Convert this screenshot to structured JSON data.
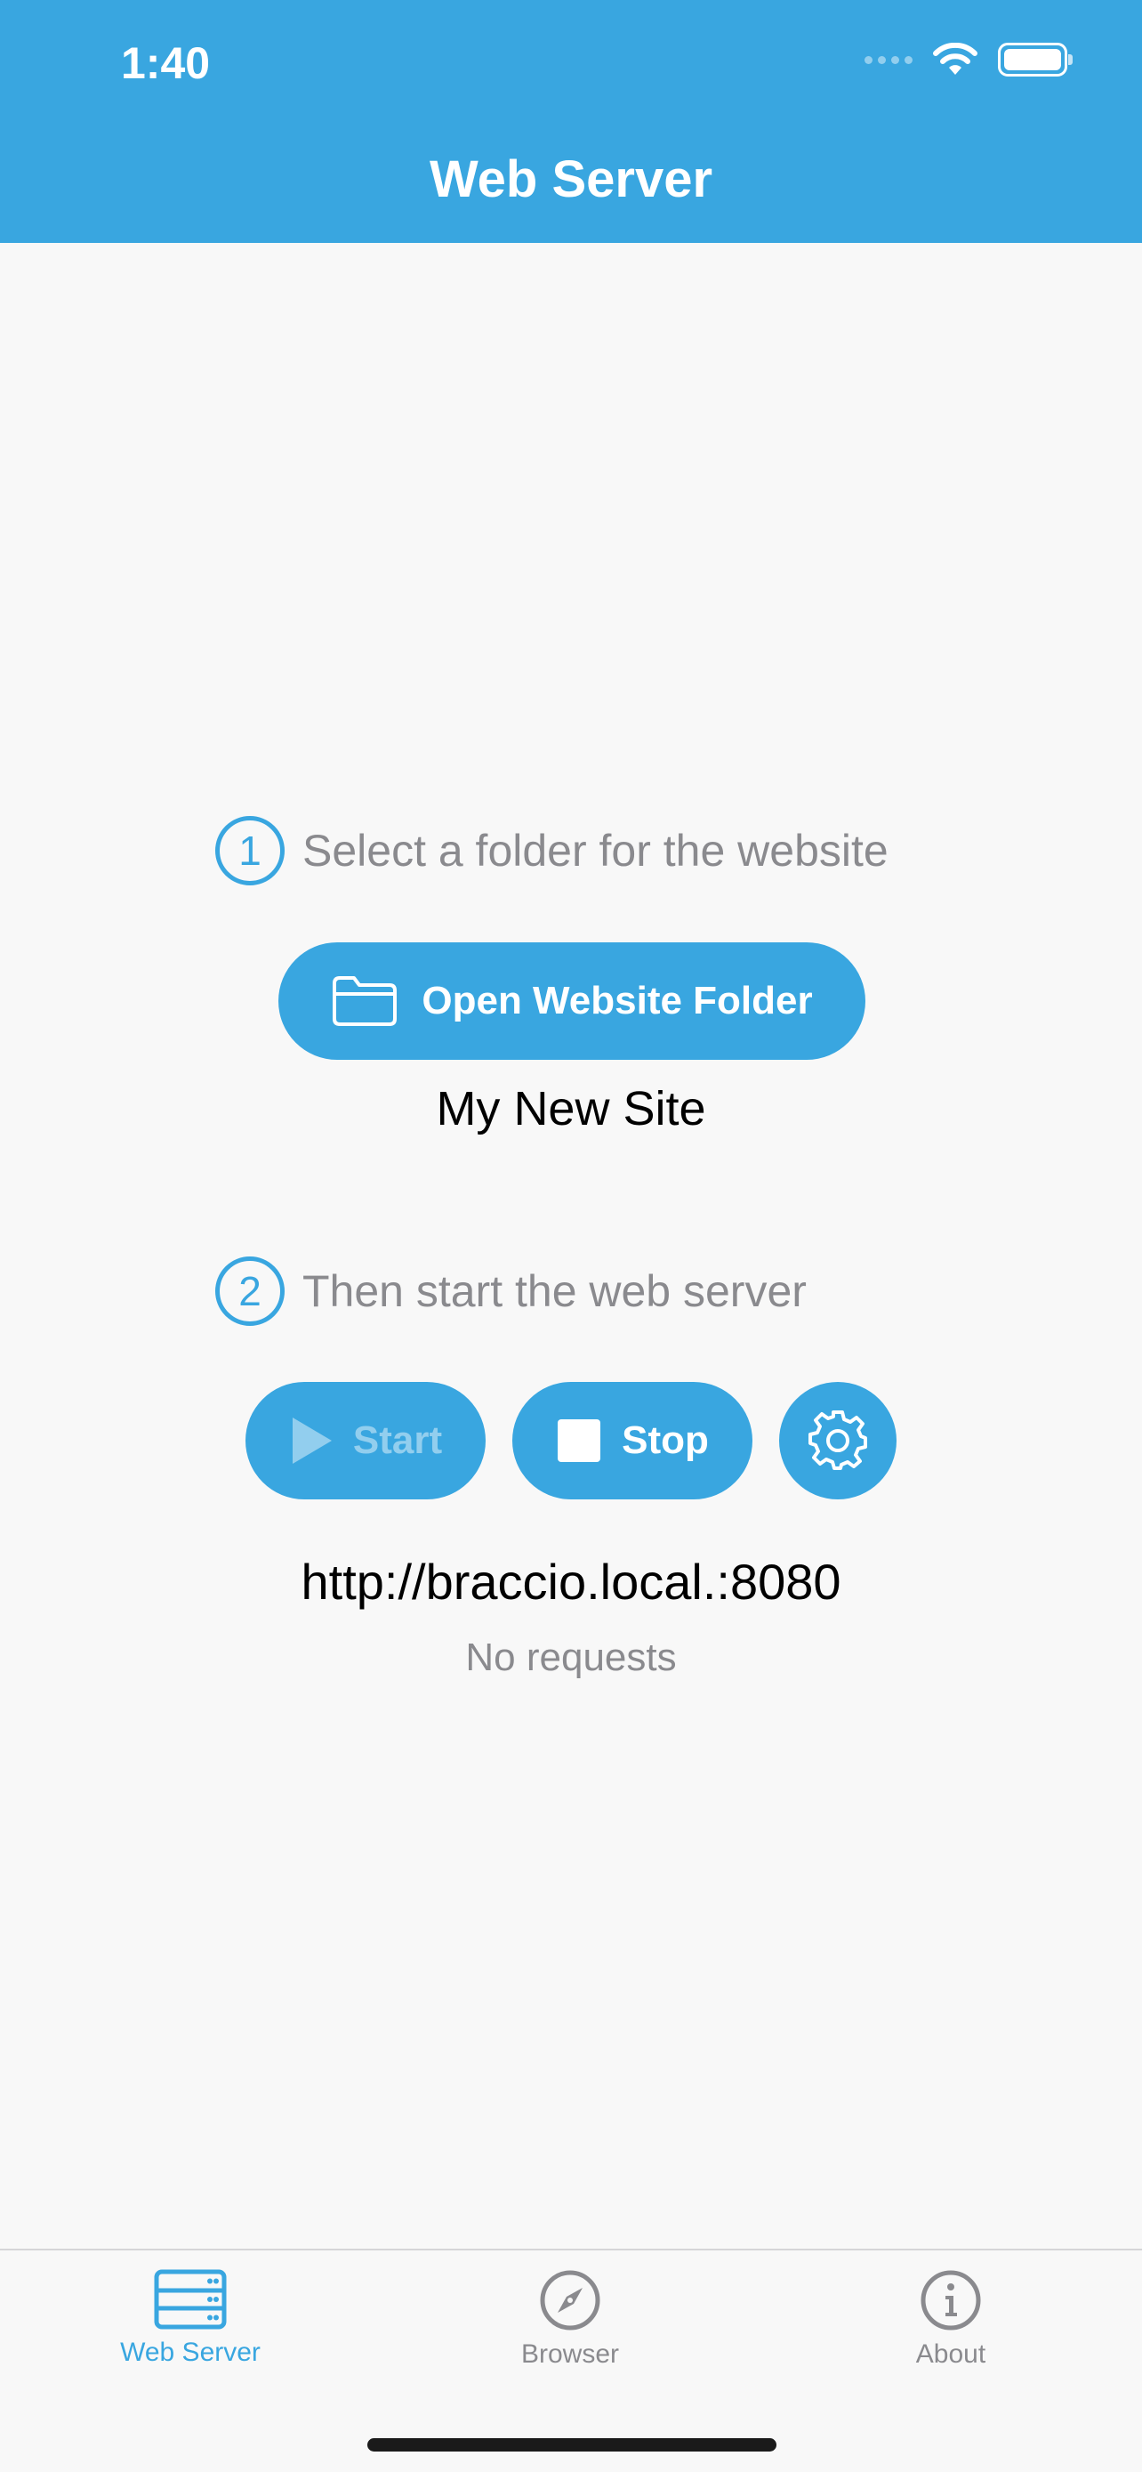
{
  "status_bar": {
    "time": "1:40"
  },
  "nav": {
    "title": "Web Server"
  },
  "step1": {
    "number": "1",
    "text": "Select a folder for the website"
  },
  "open_button": {
    "label": "Open Website Folder",
    "icon": "folder-icon"
  },
  "site": {
    "name": "My New Site"
  },
  "step2": {
    "number": "2",
    "text": "Then start the web server"
  },
  "controls": {
    "start_label": "Start",
    "start_enabled": false,
    "stop_label": "Stop",
    "settings_icon": "gear-icon"
  },
  "server": {
    "url": "http://braccio.local.:8080",
    "requests": "No requests"
  },
  "tabs": [
    {
      "label": "Web Server",
      "icon": "server-icon",
      "active": true
    },
    {
      "label": "Browser",
      "icon": "compass-icon",
      "active": false
    },
    {
      "label": "About",
      "icon": "info-icon",
      "active": false
    }
  ],
  "colors": {
    "accent": "#39a6e0",
    "background": "#f8f8f8",
    "secondary_text": "#8a8a8e"
  }
}
